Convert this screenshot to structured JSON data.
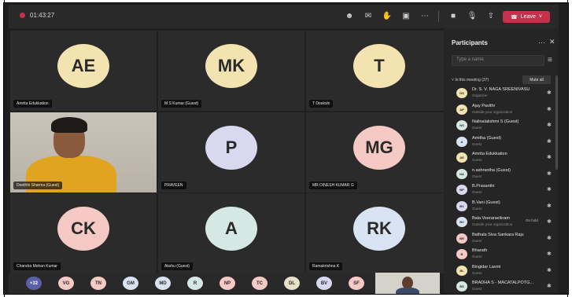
{
  "meeting": {
    "timer": "01:43:27",
    "leave_label": "Leave",
    "colors": {
      "leave": "#c4314b",
      "bg": "#202020"
    }
  },
  "toolbar": {
    "icons": [
      "people-icon",
      "chat-icon",
      "raise-hand-icon",
      "rooms-icon",
      "more-icon",
      "camera-icon",
      "mic-icon",
      "share-icon",
      "phone-icon"
    ]
  },
  "tiles": [
    {
      "initials": "AE",
      "name": "Amrita Edukkation",
      "color": "#f3e3b0"
    },
    {
      "initials": "MK",
      "name": "M S Kumar (Guest)",
      "color": "#f3e3b0"
    },
    {
      "initials": "T",
      "name": "T Deekshi",
      "color": "#f3e3b0"
    },
    {
      "initials": "",
      "name": "Deethhi Sharma (Guest)",
      "color": "#e1a421"
    },
    {
      "initials": "P",
      "name": "PRAVEEN",
      "color": "#d8d8f0"
    },
    {
      "initials": "MG",
      "name": "MR DINESH KUMAR G",
      "color": "#f5c9c4"
    },
    {
      "initials": "CK",
      "name": "Chandra Mohan Kumar",
      "color": "#f5c9c4"
    },
    {
      "initials": "A",
      "name": "Akshu (Guest)",
      "color": "#d6e8e4"
    },
    {
      "initials": "RK",
      "name": "Ramakrishna K",
      "color": "#d8e3f3"
    }
  ],
  "strip": [
    {
      "initials": "+32",
      "color": "#5a5fa8"
    },
    {
      "initials": "VG",
      "color": "#f5c9c4"
    },
    {
      "initials": "TN",
      "color": "#f5c9c4"
    },
    {
      "initials": "GM",
      "color": "#d8e3f3"
    },
    {
      "initials": "MD",
      "color": "#d8e3f3"
    },
    {
      "initials": "R",
      "color": "#d6e8e4"
    },
    {
      "initials": "NP",
      "color": "#f5c9c4"
    },
    {
      "initials": "TC",
      "color": "#f5c9c4"
    },
    {
      "initials": "DL",
      "color": "#e6e1c8"
    },
    {
      "initials": "BV",
      "color": "#d8d8f0"
    },
    {
      "initials": "SF",
      "color": "#f5c9c4"
    }
  ],
  "panel": {
    "title": "Participants",
    "search_placeholder": "Type a name",
    "in_meeting_label": "In this meeting (37)",
    "mute_all_label": "Mute all",
    "participants": [
      {
        "initials": "DS",
        "name": "Dr. S. V. NAGA SREENIVASU",
        "role": "Organizer",
        "color": "#f3e3b0",
        "status": ""
      },
      {
        "initials": "AP",
        "name": "Ajay Pavithr",
        "role": "Outside your organization",
        "color": "#f3e3b0",
        "status": ""
      },
      {
        "initials": "NS",
        "name": "Nalinalakshmi S (Guest)",
        "role": "Guest",
        "color": "#d6e8e4",
        "status": ""
      },
      {
        "initials": "A",
        "name": "Amitha (Guest)",
        "role": "Guest",
        "color": "#d8e3f3",
        "status": ""
      },
      {
        "initials": "AE",
        "name": "Amrita Edukkation",
        "role": "Guest",
        "color": "#f3e3b0",
        "status": ""
      },
      {
        "initials": "NA",
        "name": "n.ashrantha (Guest)",
        "role": "Guest",
        "color": "#d6e8e4",
        "status": ""
      },
      {
        "initials": "BP",
        "name": "B.Prasanthi",
        "role": "Guest",
        "color": "#d8d8f0",
        "status": ""
      },
      {
        "initials": "BV",
        "name": "B.Vani (Guest)",
        "role": "Guest",
        "color": "#d8d8f0",
        "status": ""
      },
      {
        "initials": "BV",
        "name": "Bala Veeraravikram",
        "role": "Outside your organization",
        "color": "#d8e3f3",
        "status": "On hold"
      },
      {
        "initials": "BR",
        "name": "Bathala Siva Sankara Raju",
        "role": "Guest",
        "color": "#f5c9c4",
        "status": ""
      },
      {
        "initials": "B",
        "name": "Bharath",
        "role": "Guest",
        "color": "#f5c9c4",
        "status": ""
      },
      {
        "initials": "BL",
        "name": "Bingidar Laxmi",
        "role": "Guest",
        "color": "#f3e3b0",
        "status": ""
      },
      {
        "initials": "BS",
        "name": "BRADHA S - MACATALPOTG...",
        "role": "Guest",
        "color": "#d6e8e4",
        "status": ""
      }
    ]
  }
}
